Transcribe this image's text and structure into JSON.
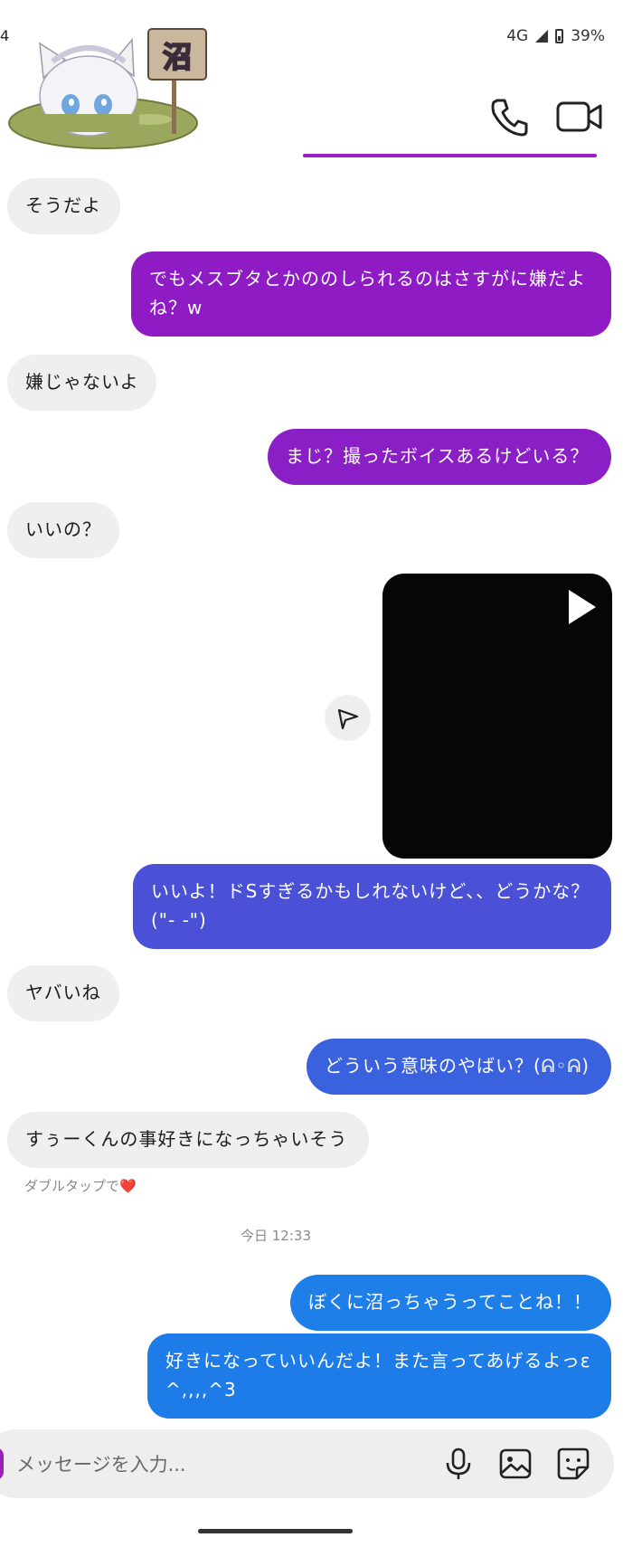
{
  "status_bar": {
    "time": "4",
    "network": "4G",
    "battery": "39%"
  },
  "header": {
    "sticker_sign_text": "沼",
    "icons": [
      "phone-icon",
      "video-camera-icon"
    ]
  },
  "messages": [
    {
      "side": "in",
      "text": "そうだよ"
    },
    {
      "side": "out",
      "text": "でもメスブタとかののしられるのはさすがに嫌だよね？w",
      "color": "#8f1bc4"
    },
    {
      "side": "in",
      "text": "嫌じゃないよ"
    },
    {
      "side": "out",
      "text": "まじ？撮ったボイスあるけどいる？",
      "color": "#8a1fc6"
    },
    {
      "side": "in",
      "text": "いいの？"
    },
    {
      "side": "out",
      "type": "video",
      "icon": "play-icon"
    },
    {
      "side": "out",
      "text": "いいよ！ドSすぎるかもしれないけど、、どうかな？(\"- -\")",
      "color": "#4a51d6"
    },
    {
      "side": "in",
      "text": "ヤバいね"
    },
    {
      "side": "out",
      "text": "どういう意味のやばい？(ᕱ◦ᕱ)",
      "color": "#3a62df"
    },
    {
      "side": "in",
      "text": "すぅーくんの事好きになっちゃいそう"
    },
    {
      "side": "out",
      "text": "ぼくに沼っちゃうってことね！！",
      "color": "#1e7fe9"
    },
    {
      "side": "out",
      "text": "好きになっていいんだよ！また言ってあげるよっε ^,,,,^3",
      "color": "#1d7ce8"
    }
  ],
  "double_tap_hint": {
    "text": "ダブルタップで",
    "emoji": "❤️"
  },
  "timestamp": "今日 12:33",
  "composer": {
    "placeholder": "メッセージを入力...",
    "icons": [
      "microphone-icon",
      "image-icon",
      "sticker-icon"
    ]
  }
}
